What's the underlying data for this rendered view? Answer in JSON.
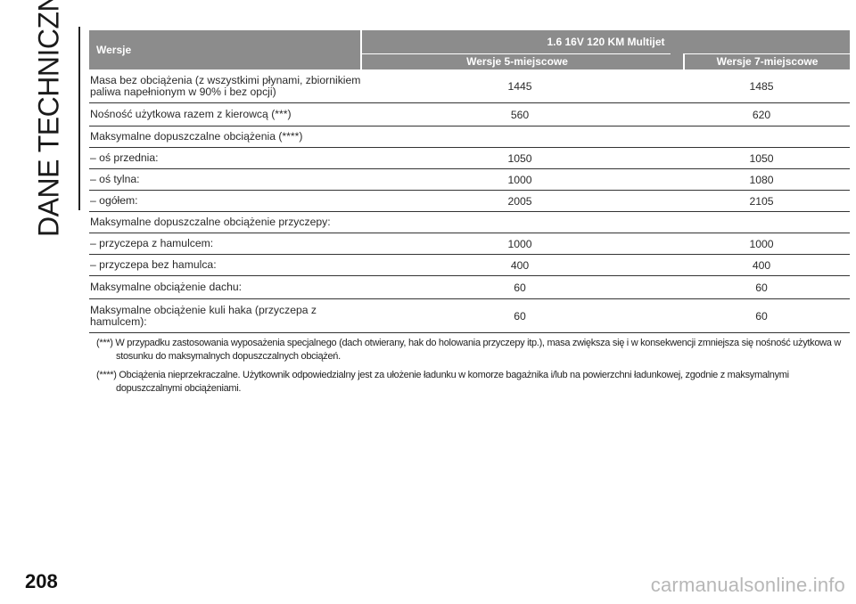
{
  "section_title": "DANE TECHNICZNE",
  "page_number": "208",
  "watermark": "carmanualsonline.info",
  "table": {
    "header": {
      "versions_label": "Wersje",
      "engine": "1.6 16V 120 KM Multijet",
      "col5": "Wersje 5-miejscowe",
      "col7": "Wersje 7-miejscowe"
    },
    "rows": [
      {
        "label": "Masa bez obciążenia (z wszystkimi płynami, zbiornikiem paliwa napełnionym w 90% i bez opcji)",
        "v5": "1445",
        "v7": "1485"
      },
      {
        "label": "Nośność użytkowa razem z kierowcą (***)",
        "v5": "560",
        "v7": "620"
      },
      {
        "label": "Maksymalne dopuszczalne obciążenia (****)",
        "v5": "",
        "v7": ""
      },
      {
        "label": "– oś przednia:",
        "v5": "1050",
        "v7": "1050"
      },
      {
        "label": "– oś tylna:",
        "v5": "1000",
        "v7": "1080"
      },
      {
        "label": "– ogółem:",
        "v5": "2005",
        "v7": "2105"
      },
      {
        "label": "Maksymalne dopuszczalne obciążenie przyczepy:",
        "v5": "",
        "v7": ""
      },
      {
        "label": "– przyczepa z hamulcem:",
        "v5": "1000",
        "v7": "1000"
      },
      {
        "label": "– przyczepa bez hamulca:",
        "v5": "400",
        "v7": "400"
      },
      {
        "label": "Maksymalne obciążenie dachu:",
        "v5": "60",
        "v7": "60"
      },
      {
        "label": "Maksymalne obciążenie kuli haka (przyczepa z hamulcem):",
        "v5": "60",
        "v7": "60"
      }
    ]
  },
  "notes": [
    "(***) W przypadku zastosowania wyposażenia specjalnego (dach otwierany, hak do holowania przyczepy itp.), masa zwiększa się i w konsekwencji zmniejsza się nośność użytkowa w stosunku do maksymalnych dopuszczalnych obciążeń.",
    "(****) Obciążenia nieprzekraczalne. Użytkownik odpowiedzialny jest za ułożenie ładunku w komorze bagażnika i/lub na powierzchni ładunkowej, zgodnie z maksymalnymi dopuszczalnymi obciążeniami."
  ]
}
